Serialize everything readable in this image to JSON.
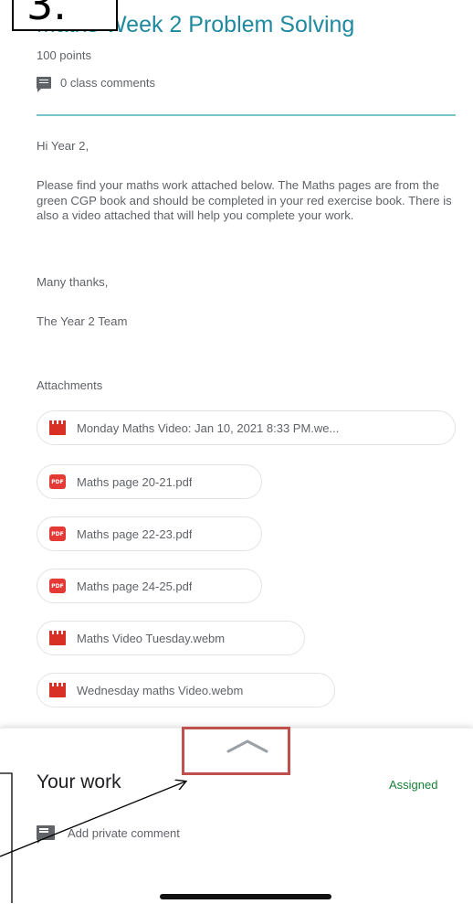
{
  "step_label": "3.",
  "assignment": {
    "title": "Maths Week 2 Problem Solving",
    "points": "100 points",
    "class_comments": "0 class comments"
  },
  "instructions": {
    "greeting": "Hi Year 2,",
    "body": "Please find your maths work attached below. The Maths pages are from the green CGP book and should be completed in your red exercise book. There is also a video attached that will help you complete your work.",
    "thanks": "Many thanks,",
    "signoff": "The Year 2 Team"
  },
  "attachments": {
    "label": "Attachments",
    "items": [
      {
        "name": "Monday Maths Video: Jan 10, 2021 8:33 PM.we...",
        "icon": "video-icon"
      },
      {
        "name": "Maths page 20-21.pdf",
        "icon": "pdf-icon"
      },
      {
        "name": "Maths page 22-23.pdf",
        "icon": "pdf-icon"
      },
      {
        "name": "Maths page 24-25.pdf",
        "icon": "pdf-icon"
      },
      {
        "name": "Maths Video Tuesday.webm",
        "icon": "video-icon"
      },
      {
        "name": "Wednesday maths Video.webm",
        "icon": "video-icon"
      }
    ],
    "pdf_badge": "PDF"
  },
  "your_work": {
    "title": "Your work",
    "status": "Assigned",
    "private_comment": "Add private comment"
  },
  "colors": {
    "title": "#1f8a9f",
    "divider": "#7dc4c9",
    "status": "#188038",
    "highlight_box": "#c0504d",
    "file_icon": "#d93025"
  }
}
